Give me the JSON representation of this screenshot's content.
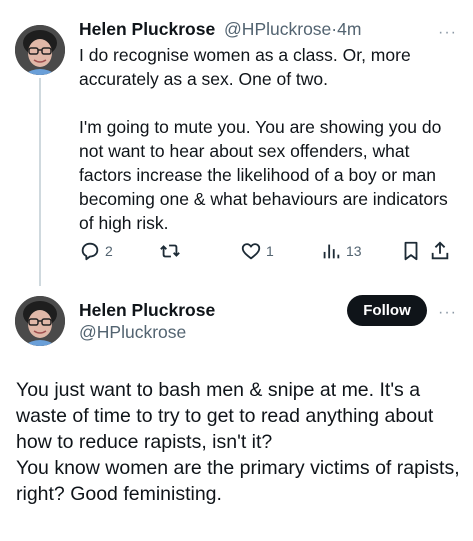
{
  "reply_tweet": {
    "author_name": "Helen Pluckrose",
    "handle": "@HPluckrose",
    "separator": "·",
    "time": "4m",
    "paragraphs": [
      "I do recognise women as a class. Or, more accurately as a sex. One of two.",
      "I'm going to mute you. You are showing you do not want to hear about sex offenders, what factors increase the likelihood of a boy or man becoming one & what behaviours are indicators of high risk."
    ],
    "actions": {
      "replies": "2",
      "retweets": "",
      "likes": "1",
      "views": "13"
    }
  },
  "main_tweet": {
    "author_name": "Helen Pluckrose",
    "handle": "@HPluckrose",
    "follow_label": "Follow",
    "body_lines": [
      "You just want to bash men & snipe at me. It's a waste of time to try to get to read anything about how to reduce rapists, isn't it?",
      "You know women are the primary victims of rapists, right? Good feministing."
    ]
  },
  "icons": {
    "reply": "reply-icon",
    "retweet": "retweet-icon",
    "like": "heart-icon",
    "views": "views-icon",
    "bookmark": "bookmark-icon",
    "share": "share-icon",
    "more": "more-icon"
  },
  "colors": {
    "text": "#0f1419",
    "muted": "#536471",
    "thread_line": "#cfd9de",
    "follow_bg": "#0f1419"
  }
}
